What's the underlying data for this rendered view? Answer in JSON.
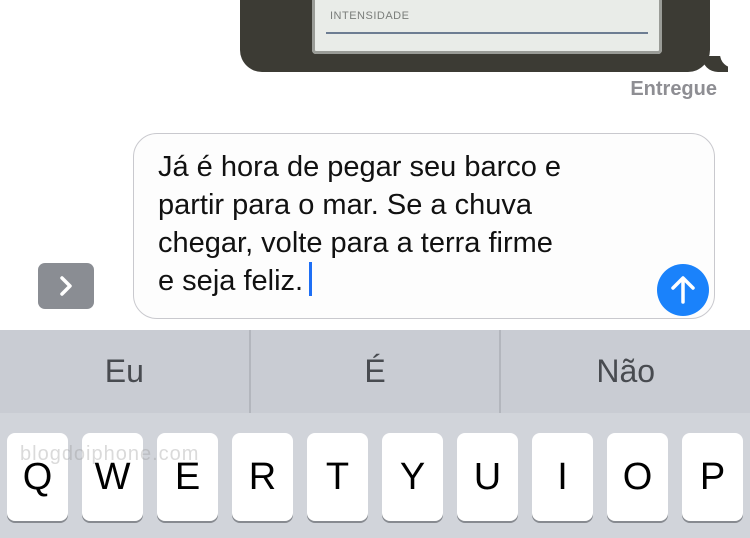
{
  "previous_message": {
    "photo_label": "INTENSIDADE",
    "status": "Entregue"
  },
  "compose": {
    "text": "Já é hora de pegar seu barco e\npartir para o mar. Se a chuva\nchegar, volte para a terra firme\ne seja feliz.",
    "send_icon": "arrow-up-icon",
    "expand_icon": "chevron-right-icon",
    "accent_color": "#1a82fb"
  },
  "keyboard": {
    "suggestions": [
      "Eu",
      "É",
      "Não"
    ],
    "keys": [
      "Q",
      "W",
      "E",
      "R",
      "T",
      "Y",
      "U",
      "I",
      "O",
      "P"
    ]
  },
  "watermark": "blogdoiphone.com"
}
